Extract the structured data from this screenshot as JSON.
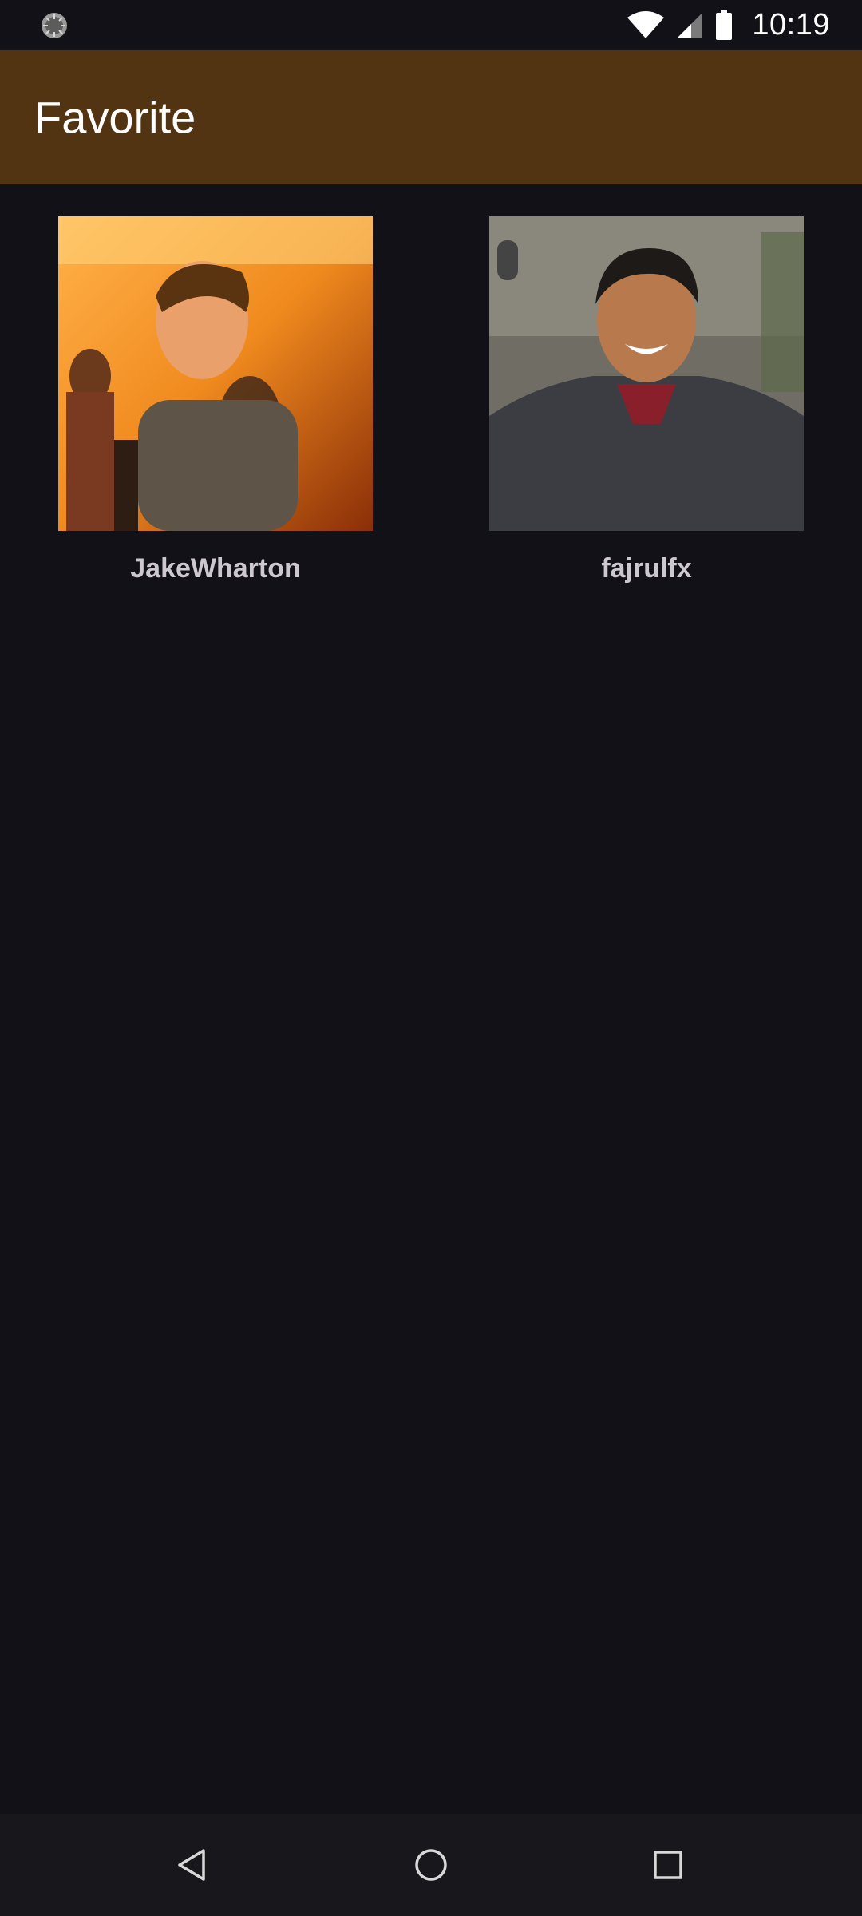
{
  "status_bar": {
    "time": "10:19",
    "icons": [
      "app-notification-icon",
      "wifi-icon",
      "cellular-signal-icon",
      "battery-icon"
    ]
  },
  "app_bar": {
    "title": "Favorite",
    "background": "#523413"
  },
  "favorites": [
    {
      "username": "JakeWharton",
      "avatar": "user-avatar-photo"
    },
    {
      "username": "fajrulfx",
      "avatar": "user-avatar-photo"
    }
  ],
  "nav_bar": {
    "buttons": [
      "back-icon",
      "home-icon",
      "recent-apps-icon"
    ]
  },
  "colors": {
    "background": "#131118",
    "app_bar": "#523413",
    "username_text": "#cdc8d0"
  }
}
